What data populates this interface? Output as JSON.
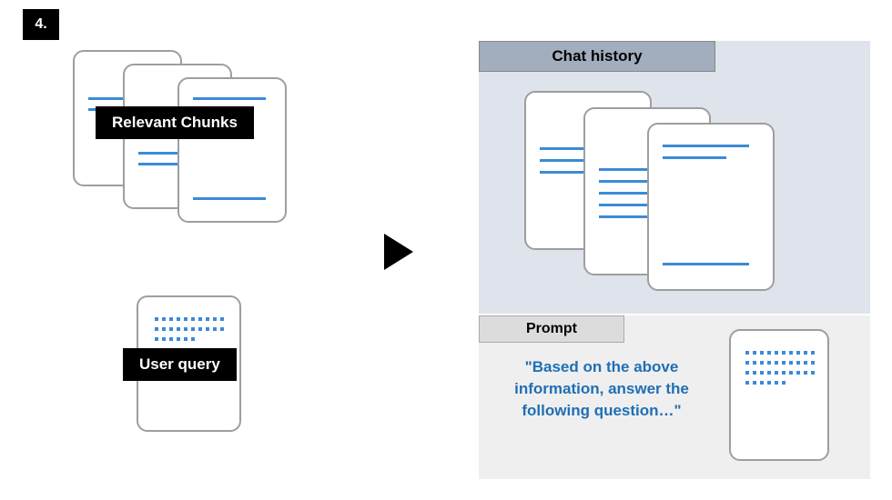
{
  "step_number": "4.",
  "left": {
    "chunks_label": "Relevant Chunks",
    "query_label": "User query"
  },
  "right": {
    "chat_history_label": "Chat history",
    "prompt_label": "Prompt",
    "prompt_text": "\"Based on the above information, answer the following question…\""
  }
}
